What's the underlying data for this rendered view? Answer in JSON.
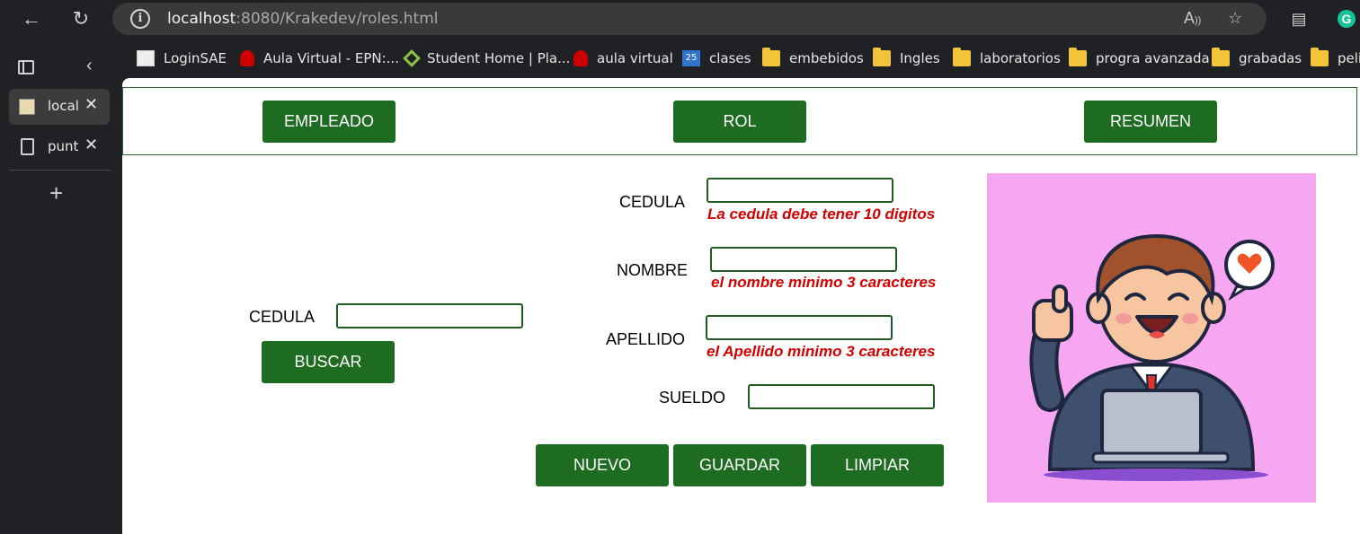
{
  "browser": {
    "url_host": "localhost",
    "url_rest": ":8080/Krakedev/roles.html",
    "bookmarks": [
      {
        "label": "LoginSAE",
        "icon": "login-icon"
      },
      {
        "label": "Aula Virtual - EPN:...",
        "icon": "epn-icon"
      },
      {
        "label": "Student Home | Pla...",
        "icon": "student-icon"
      },
      {
        "label": "aula virtual",
        "icon": "epn-icon"
      },
      {
        "label": "clases",
        "icon": "calendar-icon"
      },
      {
        "label": "embebidos",
        "icon": "folder-icon"
      },
      {
        "label": "Ingles",
        "icon": "folder-icon"
      },
      {
        "label": "laboratorios",
        "icon": "folder-icon"
      },
      {
        "label": "progra avanzada",
        "icon": "folder-icon"
      },
      {
        "label": "grabadas",
        "icon": "folder-icon"
      },
      {
        "label": "pelis",
        "icon": "folder-icon"
      }
    ],
    "tabs": [
      {
        "label": "locall",
        "active": true
      },
      {
        "label": "punto",
        "active": false
      }
    ]
  },
  "menu": {
    "empleado": "EMPLEADO",
    "rol": "ROL",
    "resumen": "RESUMEN"
  },
  "search": {
    "cedula_label": "CEDULA",
    "buscar": "BUSCAR"
  },
  "form": {
    "cedula_label": "CEDULA",
    "cedula_error": "La cedula debe tener 10 digitos",
    "nombre_label": "NOMBRE",
    "nombre_error": "el nombre minimo 3 caracteres",
    "apellido_label": "APELLIDO",
    "apellido_error": "el Apellido minimo 3 caracteres",
    "sueldo_label": "SUELDO"
  },
  "actions": {
    "nuevo": "NUEVO",
    "guardar": "GUARDAR",
    "limpiar": "LIMPIAR"
  },
  "colors": {
    "button_green": "#1e6b22",
    "error_red": "#d40000",
    "illustration_bg": "#f7a6f2"
  }
}
